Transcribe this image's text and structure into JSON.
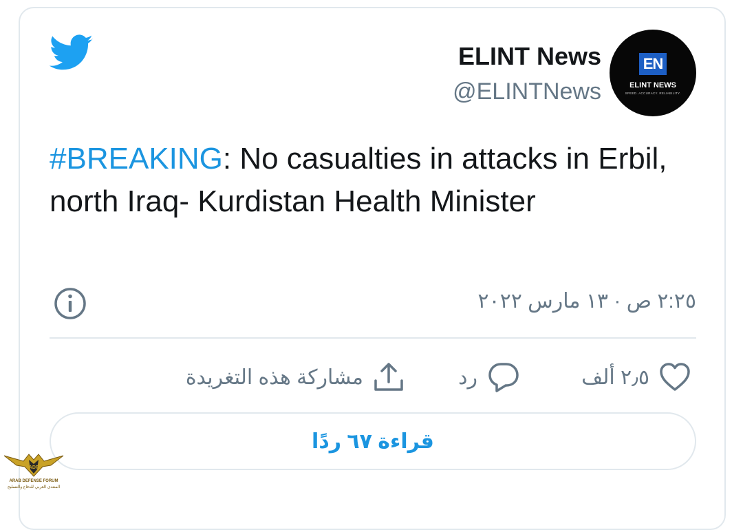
{
  "colors": {
    "accent": "#1b95e0",
    "text": "#14171a",
    "secondary": "#657786",
    "border": "#e1e8ed",
    "twitter_blue": "#1da1f2"
  },
  "icons": {
    "logo": "twitter-bird-icon",
    "info": "info-icon",
    "like": "heart-icon",
    "reply": "speech-bubble-icon",
    "share": "share-upload-icon"
  },
  "author": {
    "name": "ELINT News",
    "handle": "@ELINTNews",
    "avatar": {
      "monogram": "EN",
      "title": "ELINT NEWS",
      "tagline": "SPEED. ACCURACY. RELIABILITY."
    }
  },
  "tweet": {
    "hashtag": "#BREAKING",
    "body": ": No casualties in attacks in Erbil, north Iraq- Kurdistan Health Minister",
    "timestamp": "٢:٢٥ ص · ١٣ مارس ٢٠٢٢"
  },
  "actions": {
    "likes_count": "٢٫٥ ألف",
    "reply_label": "رد",
    "share_label": "مشاركة هذه التغريدة"
  },
  "read_replies_label": "قراءة ٦٧ ردًا",
  "watermark": {
    "text_en": "ARAB DEFENSE FORUM",
    "text_ar": "المنتدى العربي للدفاع والتسليح"
  }
}
